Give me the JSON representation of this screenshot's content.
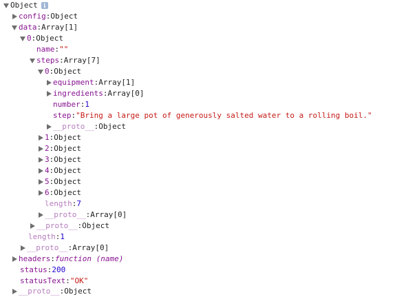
{
  "root": {
    "label": "Object",
    "info_glyph": "i"
  },
  "rows": [
    {
      "key": "config",
      "value": "Object"
    },
    {
      "key": "data",
      "value": "Array[1]"
    },
    {
      "key": "0",
      "value": "Object"
    },
    {
      "key": "name",
      "value": "\"\""
    },
    {
      "key": "steps",
      "value": "Array[7]"
    },
    {
      "key": "0",
      "value": "Object"
    },
    {
      "key": "equipment",
      "value": "Array[1]"
    },
    {
      "key": "ingredients",
      "value": "Array[0]"
    },
    {
      "key": "number",
      "value": "1"
    },
    {
      "key": "step",
      "value": "\"Bring a large pot of generously salted water to a rolling boil.\""
    },
    {
      "key": "__proto__",
      "value": "Object"
    },
    {
      "key": "1",
      "value": "Object"
    },
    {
      "key": "2",
      "value": "Object"
    },
    {
      "key": "3",
      "value": "Object"
    },
    {
      "key": "4",
      "value": "Object"
    },
    {
      "key": "5",
      "value": "Object"
    },
    {
      "key": "6",
      "value": "Object"
    },
    {
      "key": "length",
      "value": "7"
    },
    {
      "key": "__proto__",
      "value": "Array[0]"
    },
    {
      "key": "__proto__",
      "value": "Object"
    },
    {
      "key": "length",
      "value": "1"
    },
    {
      "key": "__proto__",
      "value": "Array[0]"
    },
    {
      "key": "headers",
      "value_fn": "function",
      "value": "(name)"
    },
    {
      "key": "status",
      "value": "200"
    },
    {
      "key": "statusText",
      "value": "\"OK\""
    },
    {
      "key": "__proto__",
      "value": "Object"
    }
  ],
  "separator": ": ",
  "colors": {
    "key": "#881391",
    "key_dim": "#b77dbf",
    "string": "#c41a16",
    "number": "#1c00cf",
    "arrow": "#6e6e6e",
    "info_badge": "#9fb6d4"
  }
}
